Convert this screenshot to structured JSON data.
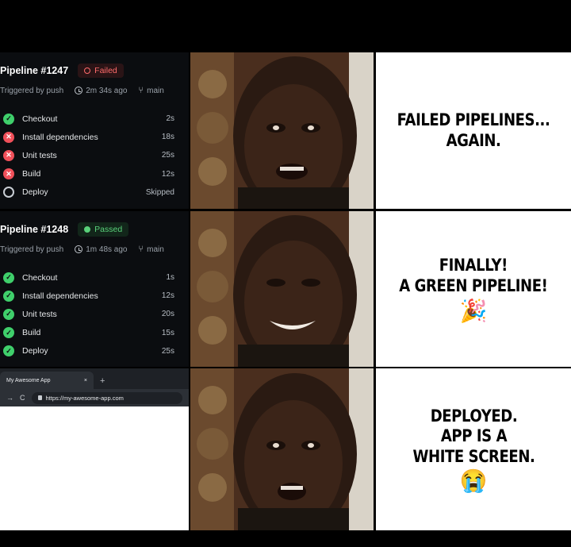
{
  "pipeline_failed": {
    "title": "Pipeline #1247",
    "status": "Failed",
    "trigger": "Triggered by push",
    "duration": "2m 34s ago",
    "branch": "main",
    "steps": [
      {
        "name": "Checkout",
        "duration": "2s",
        "state": "success"
      },
      {
        "name": "Install dependencies",
        "duration": "18s",
        "state": "failed"
      },
      {
        "name": "Unit tests",
        "duration": "25s",
        "state": "failed"
      },
      {
        "name": "Build",
        "duration": "12s",
        "state": "failed"
      },
      {
        "name": "Deploy",
        "duration": "Skipped",
        "state": "skipped"
      }
    ]
  },
  "pipeline_passed": {
    "title": "Pipeline #1248",
    "status": "Passed",
    "trigger": "Triggered by push",
    "duration": "1m 48s ago",
    "branch": "main",
    "steps": [
      {
        "name": "Checkout",
        "duration": "1s",
        "state": "success"
      },
      {
        "name": "Install dependencies",
        "duration": "12s",
        "state": "success"
      },
      {
        "name": "Unit tests",
        "duration": "20s",
        "state": "success"
      },
      {
        "name": "Build",
        "duration": "15s",
        "state": "success"
      },
      {
        "name": "Deploy",
        "duration": "25s",
        "state": "success"
      }
    ]
  },
  "browser": {
    "tab_title": "My Awesome App",
    "tab_close": "×",
    "new_tab": "+",
    "url": "https://my-awesome-app.com"
  },
  "captions": {
    "first": [
      "FAILED PIPELINES...",
      "AGAIN."
    ],
    "second": [
      "FINALLY!",
      "A GREEN PIPELINE!"
    ],
    "second_emoji": "🎉",
    "third": [
      "DEPLOYED.",
      "APP IS A",
      "WHITE SCREEN."
    ],
    "third_emoji": "😭"
  },
  "colors": {
    "failed": "#f0505a",
    "success": "#3fcf6b",
    "panel_bg": "#0b0d10"
  }
}
